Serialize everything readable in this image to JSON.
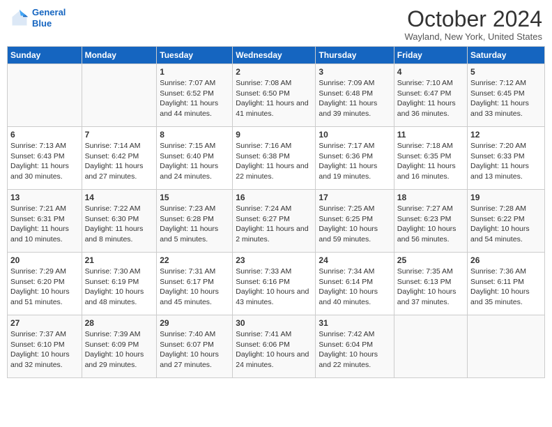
{
  "header": {
    "logo_line1": "General",
    "logo_line2": "Blue",
    "month": "October 2024",
    "location": "Wayland, New York, United States"
  },
  "days_of_week": [
    "Sunday",
    "Monday",
    "Tuesday",
    "Wednesday",
    "Thursday",
    "Friday",
    "Saturday"
  ],
  "weeks": [
    [
      {
        "day": "",
        "sunrise": "",
        "sunset": "",
        "daylight": ""
      },
      {
        "day": "",
        "sunrise": "",
        "sunset": "",
        "daylight": ""
      },
      {
        "day": "1",
        "sunrise": "Sunrise: 7:07 AM",
        "sunset": "Sunset: 6:52 PM",
        "daylight": "Daylight: 11 hours and 44 minutes."
      },
      {
        "day": "2",
        "sunrise": "Sunrise: 7:08 AM",
        "sunset": "Sunset: 6:50 PM",
        "daylight": "Daylight: 11 hours and 41 minutes."
      },
      {
        "day": "3",
        "sunrise": "Sunrise: 7:09 AM",
        "sunset": "Sunset: 6:48 PM",
        "daylight": "Daylight: 11 hours and 39 minutes."
      },
      {
        "day": "4",
        "sunrise": "Sunrise: 7:10 AM",
        "sunset": "Sunset: 6:47 PM",
        "daylight": "Daylight: 11 hours and 36 minutes."
      },
      {
        "day": "5",
        "sunrise": "Sunrise: 7:12 AM",
        "sunset": "Sunset: 6:45 PM",
        "daylight": "Daylight: 11 hours and 33 minutes."
      }
    ],
    [
      {
        "day": "6",
        "sunrise": "Sunrise: 7:13 AM",
        "sunset": "Sunset: 6:43 PM",
        "daylight": "Daylight: 11 hours and 30 minutes."
      },
      {
        "day": "7",
        "sunrise": "Sunrise: 7:14 AM",
        "sunset": "Sunset: 6:42 PM",
        "daylight": "Daylight: 11 hours and 27 minutes."
      },
      {
        "day": "8",
        "sunrise": "Sunrise: 7:15 AM",
        "sunset": "Sunset: 6:40 PM",
        "daylight": "Daylight: 11 hours and 24 minutes."
      },
      {
        "day": "9",
        "sunrise": "Sunrise: 7:16 AM",
        "sunset": "Sunset: 6:38 PM",
        "daylight": "Daylight: 11 hours and 22 minutes."
      },
      {
        "day": "10",
        "sunrise": "Sunrise: 7:17 AM",
        "sunset": "Sunset: 6:36 PM",
        "daylight": "Daylight: 11 hours and 19 minutes."
      },
      {
        "day": "11",
        "sunrise": "Sunrise: 7:18 AM",
        "sunset": "Sunset: 6:35 PM",
        "daylight": "Daylight: 11 hours and 16 minutes."
      },
      {
        "day": "12",
        "sunrise": "Sunrise: 7:20 AM",
        "sunset": "Sunset: 6:33 PM",
        "daylight": "Daylight: 11 hours and 13 minutes."
      }
    ],
    [
      {
        "day": "13",
        "sunrise": "Sunrise: 7:21 AM",
        "sunset": "Sunset: 6:31 PM",
        "daylight": "Daylight: 11 hours and 10 minutes."
      },
      {
        "day": "14",
        "sunrise": "Sunrise: 7:22 AM",
        "sunset": "Sunset: 6:30 PM",
        "daylight": "Daylight: 11 hours and 8 minutes."
      },
      {
        "day": "15",
        "sunrise": "Sunrise: 7:23 AM",
        "sunset": "Sunset: 6:28 PM",
        "daylight": "Daylight: 11 hours and 5 minutes."
      },
      {
        "day": "16",
        "sunrise": "Sunrise: 7:24 AM",
        "sunset": "Sunset: 6:27 PM",
        "daylight": "Daylight: 11 hours and 2 minutes."
      },
      {
        "day": "17",
        "sunrise": "Sunrise: 7:25 AM",
        "sunset": "Sunset: 6:25 PM",
        "daylight": "Daylight: 10 hours and 59 minutes."
      },
      {
        "day": "18",
        "sunrise": "Sunrise: 7:27 AM",
        "sunset": "Sunset: 6:23 PM",
        "daylight": "Daylight: 10 hours and 56 minutes."
      },
      {
        "day": "19",
        "sunrise": "Sunrise: 7:28 AM",
        "sunset": "Sunset: 6:22 PM",
        "daylight": "Daylight: 10 hours and 54 minutes."
      }
    ],
    [
      {
        "day": "20",
        "sunrise": "Sunrise: 7:29 AM",
        "sunset": "Sunset: 6:20 PM",
        "daylight": "Daylight: 10 hours and 51 minutes."
      },
      {
        "day": "21",
        "sunrise": "Sunrise: 7:30 AM",
        "sunset": "Sunset: 6:19 PM",
        "daylight": "Daylight: 10 hours and 48 minutes."
      },
      {
        "day": "22",
        "sunrise": "Sunrise: 7:31 AM",
        "sunset": "Sunset: 6:17 PM",
        "daylight": "Daylight: 10 hours and 45 minutes."
      },
      {
        "day": "23",
        "sunrise": "Sunrise: 7:33 AM",
        "sunset": "Sunset: 6:16 PM",
        "daylight": "Daylight: 10 hours and 43 minutes."
      },
      {
        "day": "24",
        "sunrise": "Sunrise: 7:34 AM",
        "sunset": "Sunset: 6:14 PM",
        "daylight": "Daylight: 10 hours and 40 minutes."
      },
      {
        "day": "25",
        "sunrise": "Sunrise: 7:35 AM",
        "sunset": "Sunset: 6:13 PM",
        "daylight": "Daylight: 10 hours and 37 minutes."
      },
      {
        "day": "26",
        "sunrise": "Sunrise: 7:36 AM",
        "sunset": "Sunset: 6:11 PM",
        "daylight": "Daylight: 10 hours and 35 minutes."
      }
    ],
    [
      {
        "day": "27",
        "sunrise": "Sunrise: 7:37 AM",
        "sunset": "Sunset: 6:10 PM",
        "daylight": "Daylight: 10 hours and 32 minutes."
      },
      {
        "day": "28",
        "sunrise": "Sunrise: 7:39 AM",
        "sunset": "Sunset: 6:09 PM",
        "daylight": "Daylight: 10 hours and 29 minutes."
      },
      {
        "day": "29",
        "sunrise": "Sunrise: 7:40 AM",
        "sunset": "Sunset: 6:07 PM",
        "daylight": "Daylight: 10 hours and 27 minutes."
      },
      {
        "day": "30",
        "sunrise": "Sunrise: 7:41 AM",
        "sunset": "Sunset: 6:06 PM",
        "daylight": "Daylight: 10 hours and 24 minutes."
      },
      {
        "day": "31",
        "sunrise": "Sunrise: 7:42 AM",
        "sunset": "Sunset: 6:04 PM",
        "daylight": "Daylight: 10 hours and 22 minutes."
      },
      {
        "day": "",
        "sunrise": "",
        "sunset": "",
        "daylight": ""
      },
      {
        "day": "",
        "sunrise": "",
        "sunset": "",
        "daylight": ""
      }
    ]
  ]
}
